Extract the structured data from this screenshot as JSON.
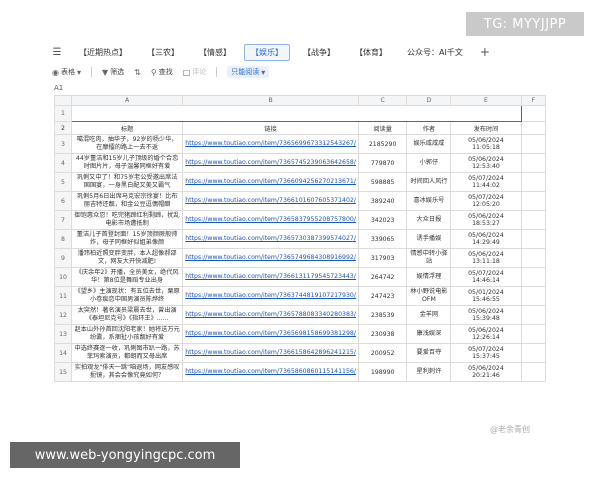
{
  "watermark_top": "TG: MYYJJPP",
  "watermark_bottom": "www.web-yongyingcpc.com",
  "watermark_logo": "@老余青创",
  "tabs": [
    {
      "label": "【近期热点】",
      "active": false
    },
    {
      "label": "【三农】",
      "active": false
    },
    {
      "label": "【情感】",
      "active": false
    },
    {
      "label": "【娱乐】",
      "active": true
    },
    {
      "label": "【战争】",
      "active": false
    },
    {
      "label": "【体育】",
      "active": false
    },
    {
      "label": "公众号：AI千文",
      "active": false
    }
  ],
  "tab_add": "+",
  "toolbar": {
    "theme": "表格",
    "filter": "筛选",
    "find": "查找",
    "comment": "评论",
    "view": "只能阅读"
  },
  "cell_ref": "A1",
  "columns": [
    "A",
    "B",
    "C",
    "D",
    "E",
    "F"
  ],
  "headers": {
    "title": "标题",
    "link": "链接",
    "views": "阅读量",
    "author": "作者",
    "time": "发布时间"
  },
  "rows": [
    {
      "n": "3",
      "title": "噶混吃肉，抽华子，92岁的杨少华，在摩擂的路上一去不返",
      "link": "https://www.toutiao.com/item/7365699673312543267/",
      "views": "2185290",
      "author": "娱乐咸咸咸",
      "time": "05/06/2024 11:05:18"
    },
    {
      "n": "4",
      "title": "44岁董洁和15岁儿子顶级的婚个合恋时图片片，母子温馨同框好有爱",
      "link": "https://www.toutiao.com/item/7365745239063642658/",
      "views": "779870",
      "author": "小郭仔",
      "time": "05/06/2024 12:53:40"
    },
    {
      "n": "5",
      "title": "巩俐又中了！和75岁老公受邀出席法国国宴，一身黑白配又美又霸气",
      "link": "https://www.toutiao.com/item/7366094256270213671/",
      "views": "598885",
      "author": "时间回人风行",
      "time": "05/07/2024 11:44:02"
    },
    {
      "n": "6",
      "title": "巩俐5月6日出席马克宏宗徐宴！比布丽吉特还靓，和金公豆逗偶帽醋",
      "link": "https://www.toutiao.com/item/7366101607605371402/",
      "views": "389240",
      "author": "喜冰娱乐号",
      "time": "05/07/2024 12:05:20"
    },
    {
      "n": "7",
      "title": "御饱惠众忍！吃完猪蹄红利剩蹄，扰乱电影市场遭抵制",
      "link": "https://www.toutiao.com/item/7365837955208757800/",
      "views": "342023",
      "author": "大众日报",
      "time": "05/06/2024 18:53:27"
    },
    {
      "n": "8",
      "title": "董洁儿子首登封面！15岁顶颜厥般帅炸，母子同框好似姐弟像颜",
      "link": "https://www.toutiao.com/item/7365730387399574027/",
      "views": "339065",
      "author": "诱手播娱",
      "time": "05/06/2024 14:29:49"
    },
    {
      "n": "9",
      "title": "潘玮柏近照变胖变胖，本人超像郝邵文，网友大开快减肥!",
      "link": "https://www.toutiao.com/item/7365749684308916992/",
      "views": "317903",
      "author": "情感中转小驿站",
      "time": "05/06/2024 13:11:18"
    },
    {
      "n": "10",
      "title": "《庆余年2》开播，全员美女，绝代风华！第8位是舞蹈专业出身",
      "link": "https://www.toutiao.com/item/7366131179545723443/",
      "views": "264742",
      "author": "娱情浮理",
      "time": "05/07/2024 14:46:14"
    },
    {
      "n": "11",
      "title": "《望乡》主演现状：有五位去世，栗原小卷痴恋中国男演员陈烨终",
      "link": "https://www.toutiao.com/item/7363744819107217930/",
      "views": "247423",
      "author": "林小野说电影OFM",
      "time": "05/01/2024 15:46:55"
    },
    {
      "n": "12",
      "title": "太突然！著名演员梁晨去世，曾出演《泰坦尼克号》《指环王》......",
      "link": "https://www.toutiao.com/item/7365788083340280383/",
      "views": "238539",
      "author": "金羊网",
      "time": "05/06/2024 15:39:48"
    },
    {
      "n": "13",
      "title": "赵本山外孙首回沈阳老家！她将送万元纷囊，系捆扯小孩靓好有爱",
      "link": "https://www.toutiao.com/item/7365698158699381298/",
      "views": "230938",
      "author": "康浅娱深",
      "time": "05/06/2024 12:26:14"
    },
    {
      "n": "14",
      "title": "中选终赛逐一收，巩俐图市趴一路，苏菲玛索演员，都朗而又母出席",
      "link": "https://www.toutiao.com/item/7366158642896241215/",
      "views": "200952",
      "author": "要爱百夺",
      "time": "05/07/2024 15:37:45"
    },
    {
      "n": "15",
      "title": "实拍观龙\"俳天一跳\"咱退场，网友感叹扼镜，其会会像究竟如何？",
      "link": "https://www.toutiao.com/item/7365860860115141156/",
      "views": "198990",
      "author": "星利刺许",
      "time": "05/06/2024 20:21:46"
    }
  ]
}
